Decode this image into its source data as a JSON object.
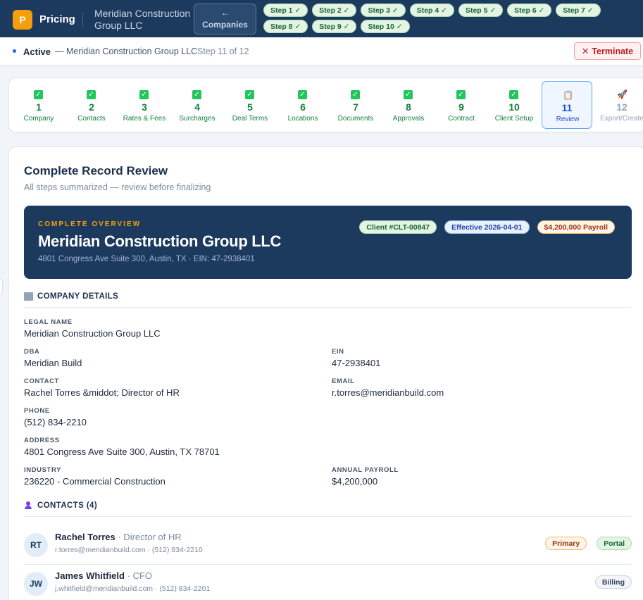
{
  "header": {
    "logo_letter": "P",
    "app_title": "Pricing",
    "company_name": "Meridian Construction Group LLC",
    "back_arrow": "←",
    "back_label": "Companies",
    "step_pills": [
      "Step 1 ✓",
      "Step 2 ✓",
      "Step 3 ✓",
      "Step 4 ✓",
      "Step 5 ✓",
      "Step 6 ✓",
      "Step 7 ✓",
      "Step 8 ✓",
      "Step 9 ✓",
      "Step 10 ✓"
    ]
  },
  "status": {
    "active": "Active",
    "company": "— Meridian Construction Group LLC",
    "step": "Step 11 of 12",
    "terminate_icon": "✕",
    "terminate_label": "Terminate"
  },
  "stepper": [
    {
      "num": "1",
      "label": "Company",
      "state": "done",
      "icon": "check-icon"
    },
    {
      "num": "2",
      "label": "Contacts",
      "state": "done",
      "icon": "check-icon"
    },
    {
      "num": "3",
      "label": "Rates & Fees",
      "state": "done",
      "icon": "check-icon"
    },
    {
      "num": "4",
      "label": "Surcharges",
      "state": "done",
      "icon": "check-icon"
    },
    {
      "num": "5",
      "label": "Deal Terms",
      "state": "done",
      "icon": "check-icon"
    },
    {
      "num": "6",
      "label": "Locations",
      "state": "done",
      "icon": "check-icon"
    },
    {
      "num": "7",
      "label": "Documents",
      "state": "done",
      "icon": "check-icon"
    },
    {
      "num": "8",
      "label": "Approvals",
      "state": "done",
      "icon": "check-icon"
    },
    {
      "num": "9",
      "label": "Contract",
      "state": "done",
      "icon": "check-icon"
    },
    {
      "num": "10",
      "label": "Client Setup",
      "state": "done",
      "icon": "check-icon"
    },
    {
      "num": "11",
      "label": "Review",
      "state": "current",
      "icon": "clipboard-icon"
    },
    {
      "num": "12",
      "label": "Export/Create",
      "state": "future",
      "icon": "rocket-icon"
    }
  ],
  "review": {
    "title": "Complete Record Review",
    "subtitle": "All steps summarized — review before finalizing"
  },
  "overview": {
    "label": "COMPLETE OVERVIEW",
    "name": "Meridian Construction Group LLC",
    "address": "4801 Congress Ave Suite 300, Austin, TX · EIN: 47-2938401",
    "badges": [
      "Client #CLT-00847",
      "Effective 2026-04-01",
      "$4,200,000 Payroll"
    ]
  },
  "company_details": {
    "heading": "COMPANY DETAILS",
    "legal_name_label": "LEGAL NAME",
    "legal_name": "Meridian Construction Group LLC",
    "dba_label": "DBA",
    "dba": "Meridian Build",
    "ein_label": "EIN",
    "ein": "47-2938401",
    "contact_label": "CONTACT",
    "contact": "Rachel Torres &middot; Director of HR",
    "email_label": "EMAIL",
    "email": "r.torres@meridianbuild.com",
    "phone_label": "PHONE",
    "phone": "(512) 834-2210",
    "address_label": "ADDRESS",
    "address": "4801 Congress Ave Suite 300, Austin, TX 78701",
    "industry_label": "INDUSTRY",
    "industry": "236220 - Commercial Construction",
    "payroll_label": "ANNUAL PAYROLL",
    "payroll": "$4,200,000"
  },
  "contacts": {
    "heading": "CONTACTS (4)",
    "items": [
      {
        "initials": "RT",
        "name": "Rachel Torres",
        "role": " · Director of HR",
        "meta": "r.torres@meridianbuild.com · (512) 834-2210",
        "tags": [
          "Primary",
          "Portal"
        ]
      },
      {
        "initials": "JW",
        "name": "James Whitfield",
        "role": " · CFO",
        "meta": "j.whitfield@meridianbuild.com · (512) 834-2201",
        "tags": [
          "Billing"
        ]
      }
    ]
  },
  "colors": {
    "navy": "#1c3a5e",
    "accent_orange": "#f59e0b",
    "success_green": "#22c55e",
    "danger_red": "#b91c1c"
  }
}
